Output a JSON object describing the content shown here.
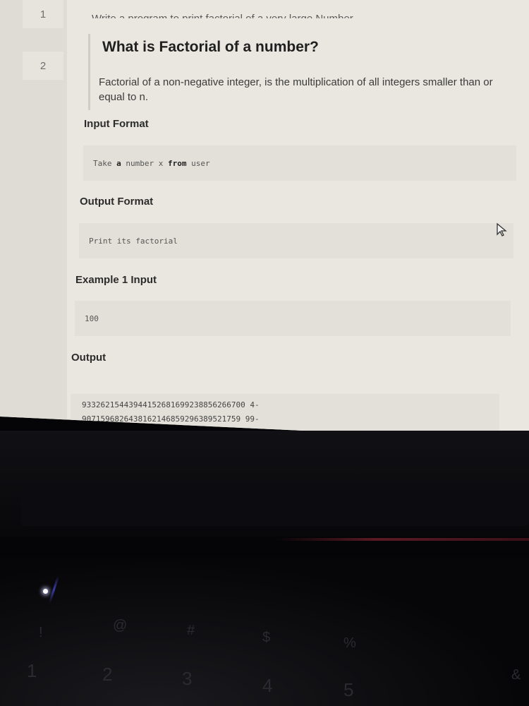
{
  "editor": {
    "line_numbers": [
      "1",
      "2"
    ],
    "clipped_top_text": "Write a program to print factorial of a very large Number.",
    "heading": "What is Factorial of a number?",
    "description": "Factorial of a non-negative integer, is the multiplication of all integers smaller than or equal to n.",
    "input_format": {
      "label": "Input Format",
      "code": {
        "w1": "Take",
        "w2": "a",
        "w3": "number",
        "w4": "x",
        "w5": "from",
        "w6": "user"
      }
    },
    "output_format": {
      "label": "Output Format",
      "code": "Print its factorial"
    },
    "example1_input": {
      "label": "Example 1 Input",
      "code": "100"
    },
    "output": {
      "label": "Output",
      "line1": "93326215443944152681699238856266700 4-",
      "line2": "9071596826438162146859296389521759 99-"
    }
  },
  "keyboard": {
    "keys": [
      "@",
      "2",
      "#",
      "3",
      "$",
      "4",
      "%",
      "5",
      "&",
      "!",
      "1"
    ]
  }
}
